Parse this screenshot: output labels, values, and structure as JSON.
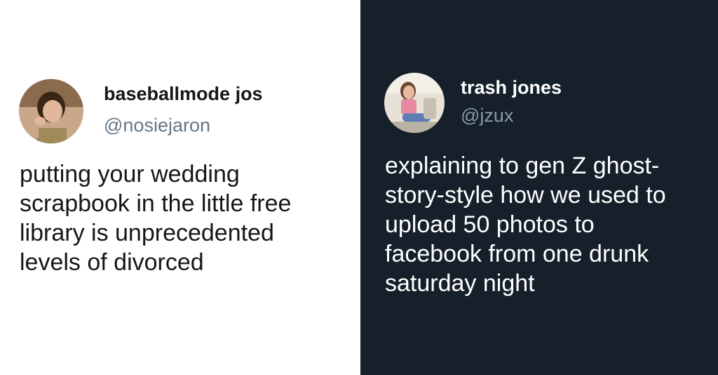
{
  "left_tweet": {
    "display_name": "baseballmode jos",
    "handle": "@nosiejaron",
    "text_lines": [
      "putting your wedding",
      "scrapbook in the little free",
      "library is unprecedented",
      "levels of divorced"
    ],
    "theme": {
      "background": "#ffffff",
      "name_color": "#14171a",
      "handle_color": "#657786"
    }
  },
  "right_tweet": {
    "display_name": "trash jones",
    "handle": "@jzux",
    "text_lines": [
      "explaining to gen Z ghost-",
      "story-style how we used to",
      "upload 50 photos to",
      "facebook from one drunk",
      "saturday night"
    ],
    "theme": {
      "background": "#15202b",
      "name_color": "#ffffff",
      "handle_color": "#8899a6"
    }
  }
}
